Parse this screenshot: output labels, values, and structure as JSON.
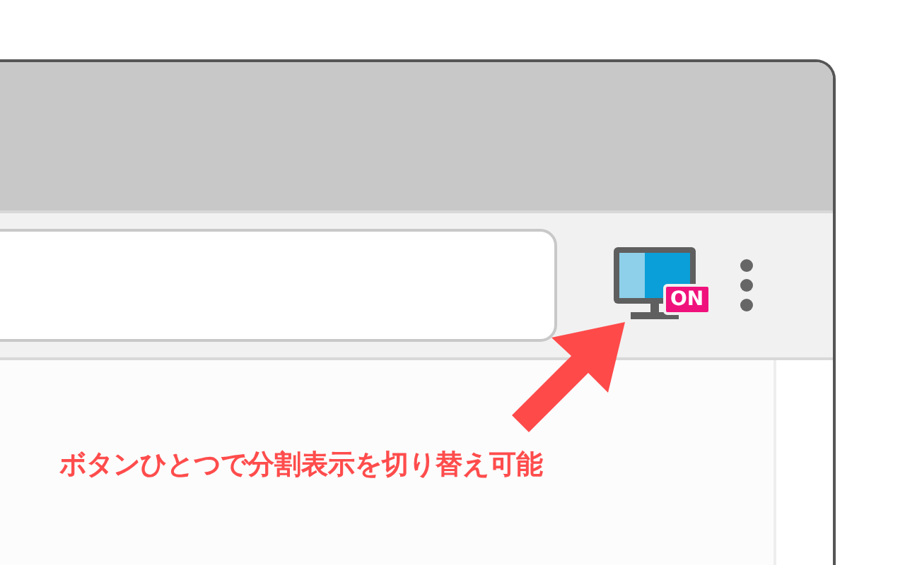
{
  "split_view_button": {
    "badge": "ON"
  },
  "annotation": {
    "text": "ボタンひとつで分割表示を切り替え可能"
  }
}
